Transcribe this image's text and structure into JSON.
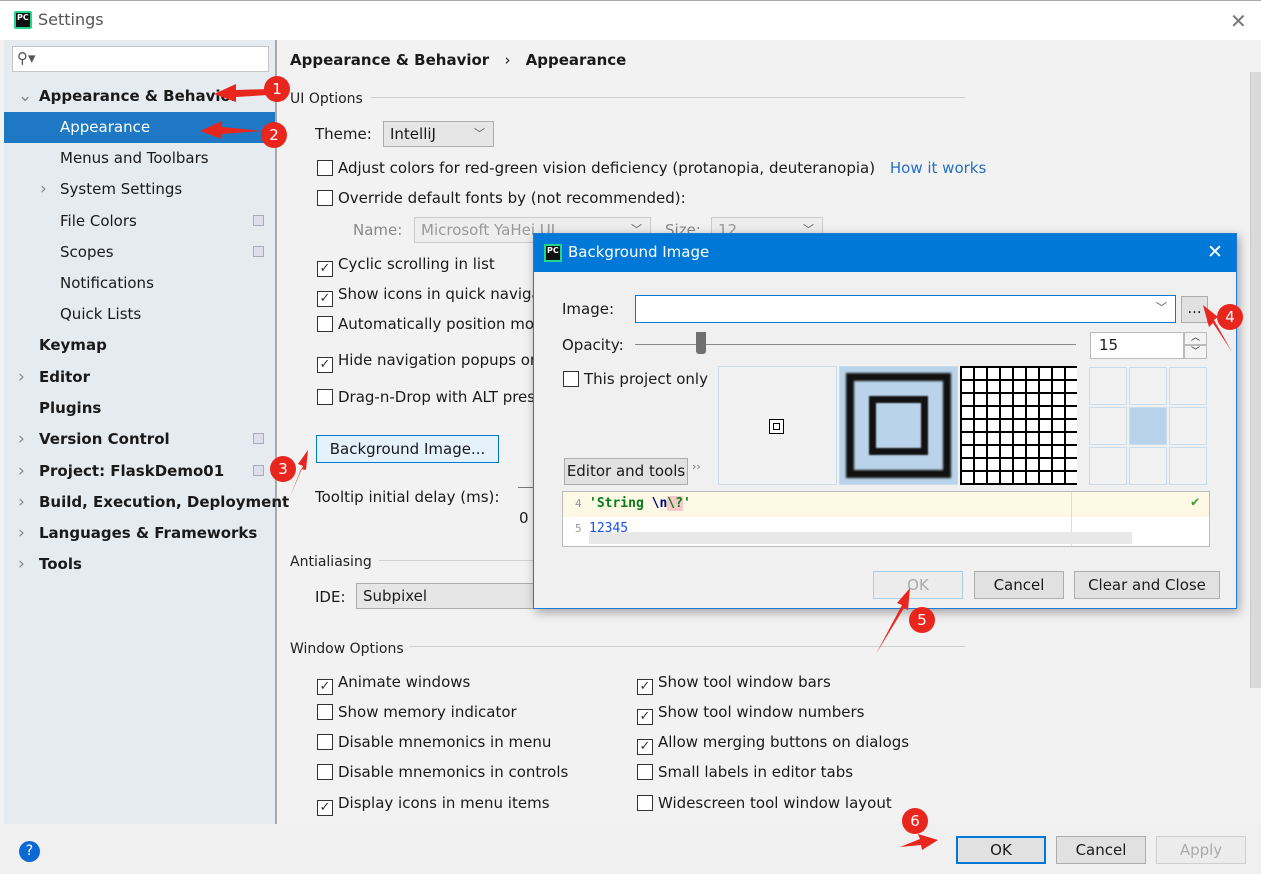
{
  "window": {
    "title": "Settings",
    "app_icon": "PC"
  },
  "sidebar": {
    "search_placeholder": "",
    "items": [
      {
        "label": "Appearance & Behavior",
        "bold": true,
        "expanded": true
      },
      {
        "label": "Appearance",
        "selected": true
      },
      {
        "label": "Menus and Toolbars"
      },
      {
        "label": "System Settings",
        "collapsed": true
      },
      {
        "label": "File Colors",
        "project_icon": true
      },
      {
        "label": "Scopes",
        "project_icon": true
      },
      {
        "label": "Notifications"
      },
      {
        "label": "Quick Lists"
      },
      {
        "label": "Keymap",
        "bold": true
      },
      {
        "label": "Editor",
        "bold": true,
        "collapsed": true
      },
      {
        "label": "Plugins",
        "bold": true
      },
      {
        "label": "Version Control",
        "bold": true,
        "collapsed": true,
        "project_icon": true
      },
      {
        "label": "Project: FlaskDemo01",
        "bold": true,
        "collapsed": true,
        "project_icon": true
      },
      {
        "label": "Build, Execution, Deployment",
        "bold": true,
        "collapsed": true
      },
      {
        "label": "Languages & Frameworks",
        "bold": true,
        "collapsed": true
      },
      {
        "label": "Tools",
        "bold": true,
        "collapsed": true
      }
    ]
  },
  "breadcrumb": {
    "parent": "Appearance & Behavior",
    "separator": "›",
    "current": "Appearance"
  },
  "ui_options": {
    "title": "UI Options",
    "theme_label": "Theme:",
    "theme_value": "IntelliJ",
    "adjust_colors": {
      "label": "Adjust colors for red-green vision deficiency (protanopia, deuteranopia)",
      "checked": false,
      "link": "How it works"
    },
    "override_fonts": {
      "label": "Override default fonts by (not recommended):",
      "checked": false
    },
    "font_name_label": "Name:",
    "font_name_value": "Microsoft YaHei UI",
    "font_size_label": "Size:",
    "font_size_value": "12",
    "cyclic_scrolling": {
      "label": "Cyclic scrolling in list",
      "checked": true
    },
    "show_icons": {
      "label": "Show icons in quick navigat",
      "checked": true
    },
    "auto_position": {
      "label": "Automatically position mou",
      "checked": false
    },
    "hide_nav": {
      "label": "Hide navigation popups on",
      "checked": true
    },
    "drag_alt": {
      "label": "Drag-n-Drop with ALT pres",
      "checked": false
    },
    "background_button": "Background Image...",
    "tooltip_label": "Tooltip initial delay (ms):",
    "tooltip_tick": "0"
  },
  "antialiasing": {
    "title": "Antialiasing",
    "ide_label": "IDE:",
    "ide_value": "Subpixel"
  },
  "window_options": {
    "title": "Window Options",
    "left": [
      {
        "label": "Animate windows",
        "checked": true
      },
      {
        "label": "Show memory indicator",
        "checked": false
      },
      {
        "label": "Disable mnemonics in menu",
        "checked": false
      },
      {
        "label": "Disable mnemonics in controls",
        "checked": false
      },
      {
        "label": "Display icons in menu items",
        "checked": true
      }
    ],
    "right": [
      {
        "label": "Show tool window bars",
        "checked": true
      },
      {
        "label": "Show tool window numbers",
        "checked": true
      },
      {
        "label": "Allow merging buttons on dialogs",
        "checked": true
      },
      {
        "label": "Small labels in editor tabs",
        "checked": false
      },
      {
        "label": "Widescreen tool window layout",
        "checked": false
      }
    ]
  },
  "footer": {
    "help": "?",
    "ok": "OK",
    "cancel": "Cancel",
    "apply": "Apply"
  },
  "dialog": {
    "title": "Background Image",
    "image_label": "Image:",
    "image_value": "",
    "browse": "...",
    "opacity_label": "Opacity:",
    "opacity_value": "15",
    "opacity_fraction": 0.15,
    "this_project_only": {
      "label": "This project only",
      "checked": false
    },
    "target_button": "Editor and tools",
    "more": "››",
    "editor_lines": [
      {
        "num": "4",
        "code_str": "'String ",
        "code_esc": "\\n",
        "code_bad": "\\?",
        "code_end": "'"
      },
      {
        "num": "5",
        "code_num": "12345"
      }
    ],
    "ok": "OK",
    "cancel": "Cancel",
    "clear_close": "Clear and Close"
  },
  "annotations": [
    "1",
    "2",
    "3",
    "4",
    "5",
    "6"
  ],
  "colors": {
    "accent": "#0078d7",
    "selection": "#1f78c4",
    "annotation": "#e8261e",
    "link": "#2470c2"
  }
}
